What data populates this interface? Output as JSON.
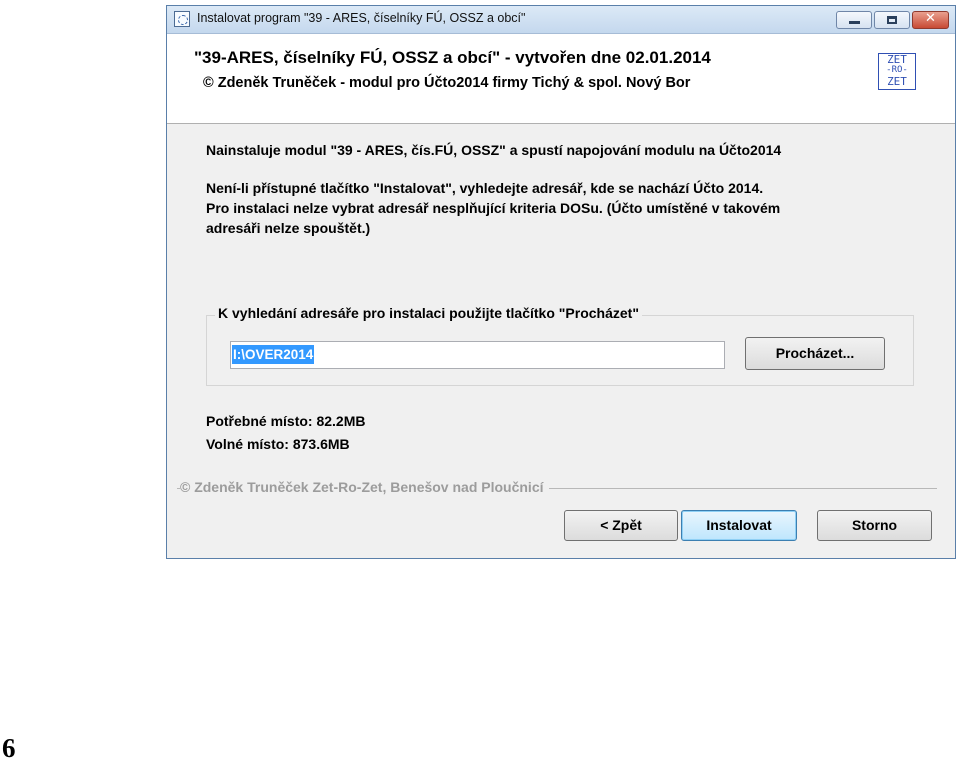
{
  "window": {
    "title": "Instalovat program \"39 - ARES, číselníky FÚ, OSSZ a obcí\"",
    "controls": {
      "minimize_icon": "minimize-icon",
      "maximize_icon": "maximize-icon",
      "close_glyph": "✕"
    }
  },
  "header": {
    "title": "\"39-ARES, číselníky FÚ, OSSZ a obcí\" - vytvořen dne 02.01.2014",
    "subtitle": "© Zdeněk Truněček - modul pro Účto2014 firmy Tichý & spol. Nový Bor",
    "logo": {
      "line1": "ZET",
      "line2": "-RO-",
      "line3": "ZET"
    }
  },
  "body": {
    "intro": "Nainstaluje modul \"39 - ARES, čís.FÚ, OSSZ\" a spustí napojování modulu na Účto2014",
    "note_line1": "Není-li přístupné tlačítko \"Instalovat\", vyhledejte adresář, kde se nachází Účto  2014.",
    "note_line2": "Pro instalaci nelze vybrat adresář nesplňující kriteria DOSu. (Účto umístěné v takovém",
    "note_line3": "adresáři nelze spouštět.)"
  },
  "directory_group": {
    "legend": "K vyhledání adresáře pro instalaci použijte tlačítko \"Procházet\"",
    "path_value": "I:\\OVER2014",
    "browse_label": "Procházet..."
  },
  "space": {
    "required": "Potřebné místo: 82.2MB",
    "free": "Volné místo: 873.6MB"
  },
  "footer": {
    "credit": "© Zdeněk Truněček Zet-Ro-Zet, Benešov nad Ploučnicí",
    "back_label": "< Zpět",
    "install_label": "Instalovat",
    "cancel_label": "Storno"
  },
  "page": {
    "number": "6"
  },
  "colors": {
    "accent": "#3399ff",
    "title_bar": "#c4d8ee",
    "window_bg": "#f0f0f0"
  }
}
